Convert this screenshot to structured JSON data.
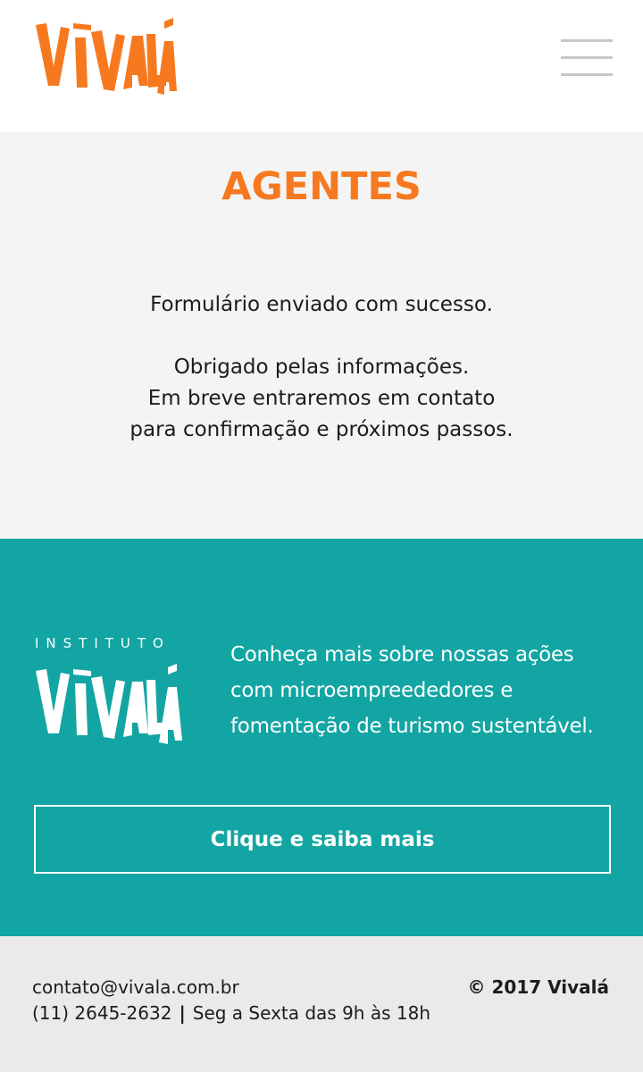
{
  "header": {
    "logo_text": "VIVALÁ",
    "menu_icon": "hamburger-menu-icon",
    "logo_color": "#f7791f"
  },
  "main": {
    "title": "AGENTES",
    "message_line1": "Formulário enviado com sucesso.",
    "message_lines": [
      "Obrigado pelas informações.",
      "Em breve entraremos em contato",
      "para confirmação e próximos passos."
    ],
    "title_color": "#f7791f",
    "background": "#f4f4f4"
  },
  "promo": {
    "institute_label": "INSTITUTO",
    "logo_text": "VIVALÁ",
    "description_lines": [
      "Conheça mais sobre nossas ações",
      "com microempreededores e",
      "fomentação de turismo sustentável."
    ],
    "cta_label": "Clique e saiba mais",
    "background": "#12a5a3"
  },
  "footer": {
    "email": "contato@vivala.com.br",
    "phone": "(11) 2645-2632",
    "separator": "|",
    "hours": "Seg a Sexta das 9h às 18h",
    "copyright": "© 2017 Vivalá",
    "background": "#ebe9e9"
  }
}
